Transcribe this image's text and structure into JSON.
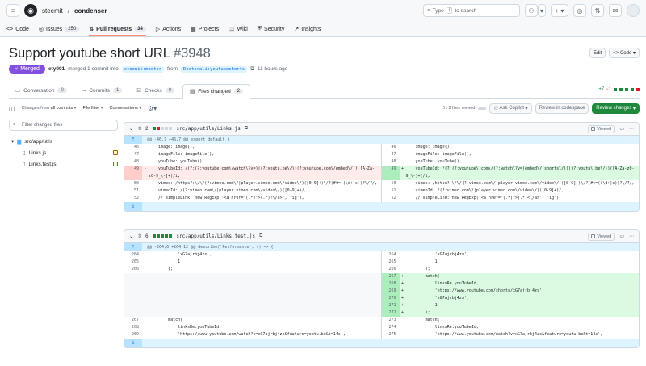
{
  "header": {
    "owner": "steemit",
    "sep": "/",
    "repo": "condenser",
    "search_prefix": "Type",
    "search_key": "/",
    "search_suffix": "to search"
  },
  "repo_nav": [
    {
      "label": "Code",
      "icon": "<>",
      "count": ""
    },
    {
      "label": "Issues",
      "icon": "◎",
      "count": "250"
    },
    {
      "label": "Pull requests",
      "icon": "⇅",
      "count": "34"
    },
    {
      "label": "Actions",
      "icon": "▷",
      "count": ""
    },
    {
      "label": "Projects",
      "icon": "▦",
      "count": ""
    },
    {
      "label": "Wiki",
      "icon": "📖",
      "count": ""
    },
    {
      "label": "Security",
      "icon": "⛨",
      "count": ""
    },
    {
      "label": "Insights",
      "icon": "↗",
      "count": ""
    }
  ],
  "pr": {
    "title": "Support youtube short URL",
    "number": "#3948",
    "edit_label": "Edit",
    "code_label": "Code",
    "status": "Merged",
    "author": "ety001",
    "merged_text": "merged 1 commit into",
    "base": "steemit:master",
    "from": "from",
    "head": "Doctorali:youtubeshorts",
    "time": "11 hours ago"
  },
  "tabs": [
    {
      "label": "Conversation",
      "count": "0"
    },
    {
      "label": "Commits",
      "count": "1"
    },
    {
      "label": "Checks",
      "count": "0"
    },
    {
      "label": "Files changed",
      "count": "2"
    }
  ],
  "diffstat": {
    "add": "+7",
    "del": "−1"
  },
  "toolbar": {
    "changes_from": "Changes from",
    "all_commits": "all commits",
    "file_filter": "File filter",
    "conversations": "Conversations",
    "files_viewed": "0 / 2 files viewed",
    "ask_copilot": "Ask Copilot",
    "review_codespace": "Review in codespace",
    "review_changes": "Review changes"
  },
  "filetree": {
    "filter_placeholder": "Filter changed files",
    "folder": "src/app/utils",
    "files": [
      "Links.js",
      "Links.test.js"
    ]
  },
  "file1": {
    "count": "2",
    "path": "src/app/utils/Links.js",
    "viewed": "Viewed",
    "hunk": "@@ -46,7 +46,7 @@ export default {",
    "left": [
      {
        "n": "46",
        "t": "ctx",
        "c": "    image: image(),"
      },
      {
        "n": "47",
        "t": "ctx",
        "c": "    imageFile: imageFile(),"
      },
      {
        "n": "48",
        "t": "ctx",
        "c": "    youTube: youTube(),"
      },
      {
        "n": "49",
        "t": "del",
        "m": "-",
        "c": "    youTubeId: /(?:(?:youtube.com\\/watch\\?v=)|(?:youtu.be\\/)|(?:youtube.com\\/embed\\/))([A-Za-z0-9_\\-]+)/i,"
      },
      {
        "n": "50",
        "t": "ctx",
        "c": "    vimeo: /https?:\\/\\/(?:vimeo.com\\/|player.vimeo.com\\/video\\/)([0-9]+)\\/?(#t=((\\d+)s))?\\/?/,"
      },
      {
        "n": "51",
        "t": "ctx",
        "c": "    vimeoId: /(?:vimeo.com\\/|player.vimeo.com\\/video\\/)([0-9]+)/,"
      },
      {
        "n": "52",
        "t": "ctx",
        "c": "    // simpleLink: new RegExp('<a href=\"(.*)\">(.*)<\\/a>', 'ig'),"
      }
    ],
    "right": [
      {
        "n": "46",
        "t": "ctx",
        "c": "    image: image(),"
      },
      {
        "n": "47",
        "t": "ctx",
        "c": "    imageFile: imageFile(),"
      },
      {
        "n": "48",
        "t": "ctx",
        "c": "    youTube: youTube(),"
      },
      {
        "n": "49",
        "t": "add",
        "m": "+",
        "c": "    youTubeId: /(?:(?:youtube\\.com\\/(?:watch\\?v=|embed\\/|shorts\\/))|(?:youtu\\.be\\/))([A-Za-z0-9_\\-]+)/i,"
      },
      {
        "n": "50",
        "t": "ctx",
        "c": "    vimeo: /https?:\\/\\/(?:vimeo.com\\/|player.vimeo.com\\/video\\/)([0-9]+)\\/?(#t=((\\d+)s))?\\/?/,"
      },
      {
        "n": "51",
        "t": "ctx",
        "c": "    vimeoId: /(?:vimeo.com\\/|player.vimeo.com\\/video\\/)([0-9]+)/,"
      },
      {
        "n": "52",
        "t": "ctx",
        "c": "    // simpleLink: new RegExp('<a href=\"(.*)\">(.*)<\\/a>', 'ig'),"
      }
    ]
  },
  "file2": {
    "count": "6",
    "path": "src/app/utils/Links.test.js",
    "viewed": "Viewed",
    "hunk": "@@ -264,6 +264,12 @@ describe('Performance', () => {",
    "left": [
      {
        "n": "264",
        "t": "ctx",
        "c": "            'xG7ajrbj4zs',"
      },
      {
        "n": "265",
        "t": "ctx",
        "c": "            1"
      },
      {
        "n": "266",
        "t": "ctx",
        "c": "        );"
      },
      {
        "n": "",
        "t": "empty",
        "c": ""
      },
      {
        "n": "",
        "t": "empty",
        "c": ""
      },
      {
        "n": "",
        "t": "empty",
        "c": ""
      },
      {
        "n": "",
        "t": "empty",
        "c": ""
      },
      {
        "n": "",
        "t": "empty",
        "c": ""
      },
      {
        "n": "",
        "t": "empty",
        "c": ""
      },
      {
        "n": "267",
        "t": "ctx",
        "c": "        match("
      },
      {
        "n": "268",
        "t": "ctx",
        "c": "            linksRe.youTubeId,"
      },
      {
        "n": "269",
        "t": "ctx",
        "c": "            'https://www.youtube.com/watch?v=xG7ajrbj4zs&feature=youtu.be&t=14s',"
      }
    ],
    "right": [
      {
        "n": "264",
        "t": "ctx",
        "c": "            'xG7ajrbj4zs',"
      },
      {
        "n": "265",
        "t": "ctx",
        "c": "            1"
      },
      {
        "n": "266",
        "t": "ctx",
        "c": "        );"
      },
      {
        "n": "267",
        "t": "add",
        "m": "+",
        "c": "        match("
      },
      {
        "n": "268",
        "t": "add",
        "m": "+",
        "c": "            linksRe.youTubeId,"
      },
      {
        "n": "269",
        "t": "add",
        "m": "+",
        "c": "            'https://www.youtube.com/shorts/xG7ajrbj4zs',"
      },
      {
        "n": "270",
        "t": "add",
        "m": "+",
        "c": "            'xG7ajrbj4zs',"
      },
      {
        "n": "271",
        "t": "add",
        "m": "+",
        "c": "            1"
      },
      {
        "n": "272",
        "t": "add",
        "m": "+",
        "c": "        );"
      },
      {
        "n": "273",
        "t": "ctx",
        "c": "        match("
      },
      {
        "n": "274",
        "t": "ctx",
        "c": "            linksRe.youTubeId,"
      },
      {
        "n": "275",
        "t": "ctx",
        "c": "            'https://www.youtube.com/watch?v=xG7ajrbj4zs&feature=youtu.be&t=14s',"
      }
    ]
  }
}
